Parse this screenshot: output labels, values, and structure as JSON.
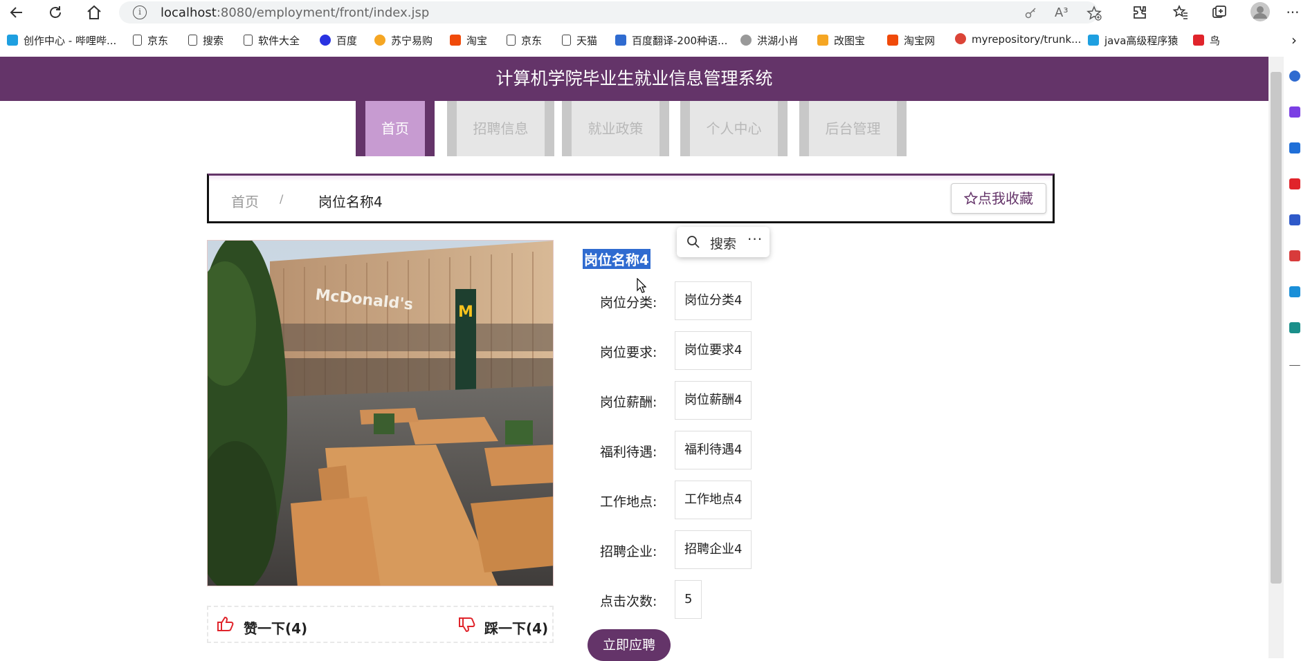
{
  "browser": {
    "url_host": "localhost",
    "url_path": ":8080/employment/front/index.jsp",
    "read_aloud_label": "A³"
  },
  "bookmarks": [
    {
      "label": "创作中心 - 哔哩哔...",
      "icon": "bilibili-icon",
      "color": "#1e9fe0"
    },
    {
      "label": "京东",
      "icon": "page-icon",
      "color": "#fff"
    },
    {
      "label": "搜索",
      "icon": "page-icon",
      "color": "#fff"
    },
    {
      "label": "软件大全",
      "icon": "page-icon",
      "color": "#fff"
    },
    {
      "label": "百度",
      "icon": "baidu-icon",
      "color": "#2932e1"
    },
    {
      "label": "苏宁易购",
      "icon": "suning-icon",
      "color": "#f5a623"
    },
    {
      "label": "淘宝",
      "icon": "taobao-icon",
      "color": "#f04a0a"
    },
    {
      "label": "京东",
      "icon": "page-icon",
      "color": "#fff"
    },
    {
      "label": "天猫",
      "icon": "page-icon",
      "color": "#fff"
    },
    {
      "label": "百度翻译-200种语...",
      "icon": "baidu-translate-icon",
      "color": "#2f6bd0"
    },
    {
      "label": "洪湖小肖",
      "icon": "bird-icon",
      "color": "#888"
    },
    {
      "label": "改图宝",
      "icon": "gaitubao-icon",
      "color": "#f5a623"
    },
    {
      "label": "淘宝网",
      "icon": "taobao-icon",
      "color": "#f04a0a"
    },
    {
      "label": "myrepository/trunk...",
      "icon": "chrome-icon",
      "color": "#db4437"
    },
    {
      "label": "java高级程序猿",
      "icon": "bilibili-icon",
      "color": "#1e9fe0"
    },
    {
      "label": "鸟",
      "icon": "bird-icon",
      "color": "#e0242b"
    }
  ],
  "site": {
    "title": "计算机学院毕业生就业信息管理系统",
    "nav": [
      "首页",
      "招聘信息",
      "就业政策",
      "个人中心",
      "后台管理"
    ],
    "active_nav": "首页"
  },
  "breadcrumb": {
    "home": "首页",
    "separator": "/",
    "current": "岗位名称4"
  },
  "favorite_label": "点我收藏",
  "job": {
    "title": "岗位名称4",
    "fields": [
      {
        "label": "岗位分类:",
        "value": "岗位分类4"
      },
      {
        "label": "岗位要求:",
        "value": "岗位要求4"
      },
      {
        "label": "岗位薪酬:",
        "value": "岗位薪酬4"
      },
      {
        "label": "福利待遇:",
        "value": "福利待遇4"
      },
      {
        "label": "工作地点:",
        "value": "工作地点4"
      },
      {
        "label": "招聘企业:",
        "value": "招聘企业4"
      },
      {
        "label": "点击次数:",
        "value": "5"
      }
    ],
    "like_label": "赞一下(4)",
    "dislike_label": "踩一下(4)",
    "apply_label": "立即应聘",
    "image_sign": "McDonald's",
    "image_logo": "M"
  },
  "selection_popup": {
    "search_label": "搜索",
    "more_label": "···"
  },
  "colors": {
    "brand_purple": "#643469",
    "active_tab": "#c79bd1",
    "inactive_tab": "#e6e6e6",
    "selection_blue": "#2f6bd0",
    "thumb_red": "#e0242b"
  }
}
